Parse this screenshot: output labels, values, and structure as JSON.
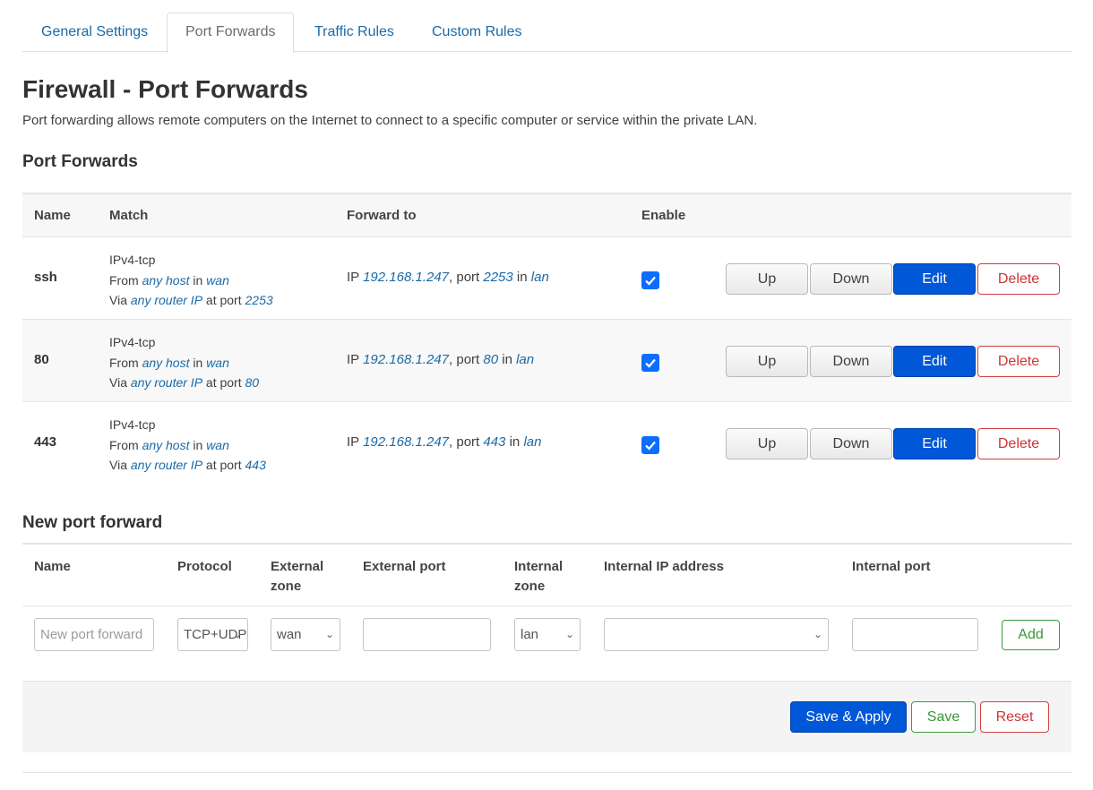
{
  "tabs": [
    {
      "label": "General Settings"
    },
    {
      "label": "Port Forwards"
    },
    {
      "label": "Traffic Rules"
    },
    {
      "label": "Custom Rules"
    }
  ],
  "title": "Firewall - Port Forwards",
  "description": "Port forwarding allows remote computers on the Internet to connect to a specific computer or service within the private LAN.",
  "section_title": "Port Forwards",
  "table_headers": {
    "name": "Name",
    "match": "Match",
    "forward_to": "Forward to",
    "enable": "Enable"
  },
  "rules": [
    {
      "name": "ssh",
      "proto": "IPv4-tcp",
      "from_host": "any host",
      "from_zone": "wan",
      "via": "any router IP",
      "ext_port": "2253",
      "ip": "192.168.1.247",
      "int_port": "2253",
      "dest_zone": "lan",
      "enabled": true
    },
    {
      "name": "80",
      "proto": "IPv4-tcp",
      "from_host": "any host",
      "from_zone": "wan",
      "via": "any router IP",
      "ext_port": "80",
      "ip": "192.168.1.247",
      "int_port": "80",
      "dest_zone": "lan",
      "enabled": true
    },
    {
      "name": "443",
      "proto": "IPv4-tcp",
      "from_host": "any host",
      "from_zone": "wan",
      "via": "any router IP",
      "ext_port": "443",
      "ip": "192.168.1.247",
      "int_port": "443",
      "dest_zone": "lan",
      "enabled": true
    }
  ],
  "text": {
    "from": "From",
    "in": "in",
    "via": "Via",
    "at_port": "at port",
    "ip": "IP",
    "port": ", port"
  },
  "row_buttons": {
    "up": "Up",
    "down": "Down",
    "edit": "Edit",
    "delete": "Delete"
  },
  "new_section_title": "New port forward",
  "new_headers": {
    "name": "Name",
    "protocol": "Protocol",
    "ext_zone": "External zone",
    "ext_port": "External port",
    "int_zone": "Internal zone",
    "int_ip": "Internal IP address",
    "int_port": "Internal port"
  },
  "new_inputs": {
    "name_placeholder": "New port forward",
    "protocol": "TCP+UDP",
    "ext_zone": "wan",
    "ext_port": "",
    "int_zone": "lan",
    "int_ip": "",
    "int_port": ""
  },
  "add_label": "Add",
  "actions": {
    "save_apply": "Save & Apply",
    "save": "Save",
    "reset": "Reset"
  }
}
